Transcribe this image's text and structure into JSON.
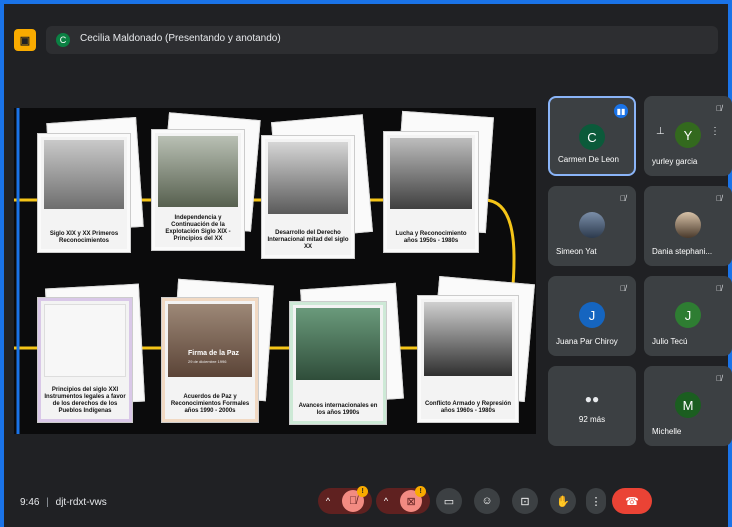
{
  "header": {
    "presenter_initial": "C",
    "presenter_label": "Cecilia Maldonado (Presentando y anotando)"
  },
  "slide": {
    "row1": [
      "Siglo XIX y XX Primeros Reconocimientos",
      "Independencia y Continuación de la Explotación Siglo XIX - Principios del XX",
      "Desarrollo del Derecho Internacional mitad del siglo XX",
      "Lucha y Reconocimiento años 1950s - 1980s"
    ],
    "row2": [
      "Principios del siglo XXI Instrumentos legales a favor de los derechos de los Pueblos Indígenas",
      "Acuerdos de Paz y Reconocimientos Formales años 1990 - 2000s",
      "Avances internacionales en los años 1990s",
      "Conflicto Armado y Represión años 1960s - 1980s"
    ],
    "peace_sign": "Firma de la Paz",
    "peace_date": "29 de diciembre 1996"
  },
  "participants": [
    {
      "name": "Carmen De Leon",
      "initial": "C",
      "color": "#0b5a3a"
    },
    {
      "name": "yurley garcia",
      "initial": "Y",
      "color": "#33691e"
    },
    {
      "name": "Simeon Yat"
    },
    {
      "name": "Dania stephani..."
    },
    {
      "name": "Juana Par Chiroy",
      "initial": "J",
      "color": "#1565c0"
    },
    {
      "name": "Julio Tecú",
      "initial": "J",
      "color": "#2e7d32"
    },
    {
      "name": "92 más"
    },
    {
      "name": "Michelle",
      "initial": "M",
      "color": "#1b5e20"
    }
  ],
  "footer": {
    "time": "9:46",
    "meeting_code": "djt-rdxt-vws",
    "mic_badge": "!",
    "cam_badge": "!"
  },
  "colors": {
    "accent": "#1a73e8",
    "track": "#f5c518",
    "hangup": "#ea4335"
  }
}
